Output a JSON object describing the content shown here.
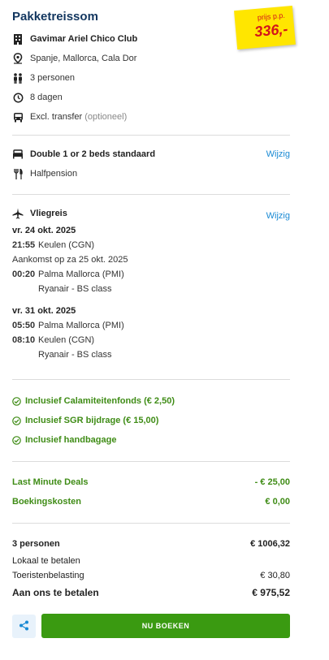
{
  "header": {
    "title": "Pakketreissom",
    "price_label": "prijs p.p.",
    "price": "336,-"
  },
  "summary": {
    "hotel": "Gavimar Ariel Chico Club",
    "location": "Spanje, Mallorca, Cala Dor",
    "persons": "3 personen",
    "duration": "8 dagen",
    "transfer": "Excl. transfer",
    "transfer_note": "(optioneel)"
  },
  "room": {
    "name": "Double 1 or 2 beds standaard",
    "board": "Halfpension",
    "edit_label": "Wijzig"
  },
  "flight": {
    "title": "Vliegreis",
    "edit_label": "Wijzig",
    "outbound": {
      "date": "vr. 24 okt. 2025",
      "dep_time": "21:55",
      "dep_place": "Keulen (CGN)",
      "arrival_note": "Aankomst op za 25 okt. 2025",
      "arr_time": "00:20",
      "arr_place": "Palma Mallorca (PMI)",
      "carrier": "Ryanair - BS class"
    },
    "return": {
      "date": "vr. 31 okt. 2025",
      "dep_time": "05:50",
      "dep_place": "Palma Mallorca (PMI)",
      "arr_time": "08:10",
      "arr_place": "Keulen (CGN)",
      "carrier": "Ryanair - BS class"
    }
  },
  "inclusions": [
    "Inclusief Calamiteitenfonds (€ 2,50)",
    "Inclusief SGR bijdrage (€ 15,00)",
    "Inclusief handbagage"
  ],
  "discounts": [
    {
      "label": "Last Minute Deals",
      "value": "- € 25,00"
    },
    {
      "label": "Boekingskosten",
      "value": "€ 0,00"
    }
  ],
  "totals": {
    "persons_label": "3 personen",
    "persons_value": "€ 1006,32",
    "local_label": "Lokaal te betalen",
    "tax_label": "Toeristenbelasting",
    "tax_value": "€ 30,80",
    "pay_label": "Aan ons te betalen",
    "pay_value": "€ 975,52"
  },
  "actions": {
    "book_label": "NU BOEKEN"
  },
  "colors": {
    "title": "#12365f",
    "accent_blue": "#1a8ad4",
    "green": "#3f8c16",
    "button_green": "#3a9a11",
    "sticker_yellow": "#ffe600",
    "sticker_red": "#d4151b"
  }
}
